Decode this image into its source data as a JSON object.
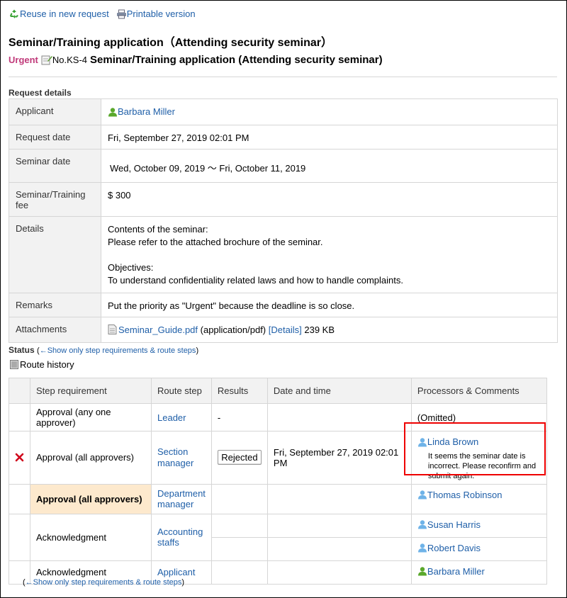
{
  "toolbar": {
    "reuse_label": "Reuse in new request",
    "print_label": "Printable version"
  },
  "page_title": "Seminar/Training application（Attending security seminar）",
  "request": {
    "priority": "Urgent",
    "number": "No.KS-4",
    "title": "Seminar/Training application (Attending security seminar)"
  },
  "details": {
    "section_label": "Request details",
    "rows": [
      {
        "label": "Applicant",
        "value": "Barbara Miller"
      },
      {
        "label": "Request date",
        "value": "Fri, September 27, 2019 02:01 PM"
      },
      {
        "label": "Seminar date",
        "value": "Wed, October 09, 2019 〜 Fri, October 11, 2019"
      },
      {
        "label": "Seminar/Training fee",
        "value": "$ 300"
      },
      {
        "label": "Details",
        "lines": [
          "Contents of the seminar:",
          "Please refer to the attached brochure of the seminar.",
          "",
          "Objectives:",
          "To understand confidentiality related laws and how to handle complaints."
        ]
      },
      {
        "label": "Remarks",
        "value": "Put the priority as \"Urgent\" because the deadline is so close."
      },
      {
        "label": "Attachments",
        "file_name": "Seminar_Guide.pdf",
        "mime": "(application/pdf)",
        "details_link": "[Details]",
        "size": "239 KB"
      }
    ]
  },
  "status": {
    "label": "Status",
    "open_paren": "(",
    "toggle_link": "←Show only step requirements & route steps",
    "close_paren": ")",
    "route_history_label": "Route history"
  },
  "route": {
    "headers": [
      "",
      "Step requirement",
      "Route step",
      "Results",
      "Date and time",
      "Processors & Comments"
    ],
    "rows": [
      {
        "requirement": "Approval (any one approver)",
        "step": "Leader",
        "result": "-",
        "datetime": "",
        "processor": "(Omitted)"
      },
      {
        "requirement": "Approval (all approvers)",
        "step": "Section manager",
        "result": "Rejected",
        "datetime": "Fri, September 27, 2019 02:01 PM",
        "processor": "Linda Brown",
        "comment": "It seems the seminar date is incorrect. Please reconfirm and submit again."
      },
      {
        "requirement": "Approval (all approvers)",
        "step": "Department manager",
        "result": "",
        "datetime": "",
        "processor": "Thomas Robinson"
      },
      {
        "requirement": "Acknowledgment",
        "step": "Accounting staffs",
        "processors": [
          "Susan Harris",
          "Robert Davis"
        ]
      },
      {
        "requirement": "Acknowledgment",
        "step": "Applicant",
        "result": "",
        "datetime": "",
        "processor": "Barbara Miller"
      }
    ]
  },
  "bottom": {
    "open_paren": "(",
    "toggle_link": "←Show only step requirements & route steps",
    "close_paren": ")"
  },
  "colors": {
    "link": "#1f5fa8",
    "urgent": "#c03a7a",
    "current_step_bg": "#fde9cd",
    "highlight_border": "#e00000",
    "reject_mark": "#d0021b"
  }
}
